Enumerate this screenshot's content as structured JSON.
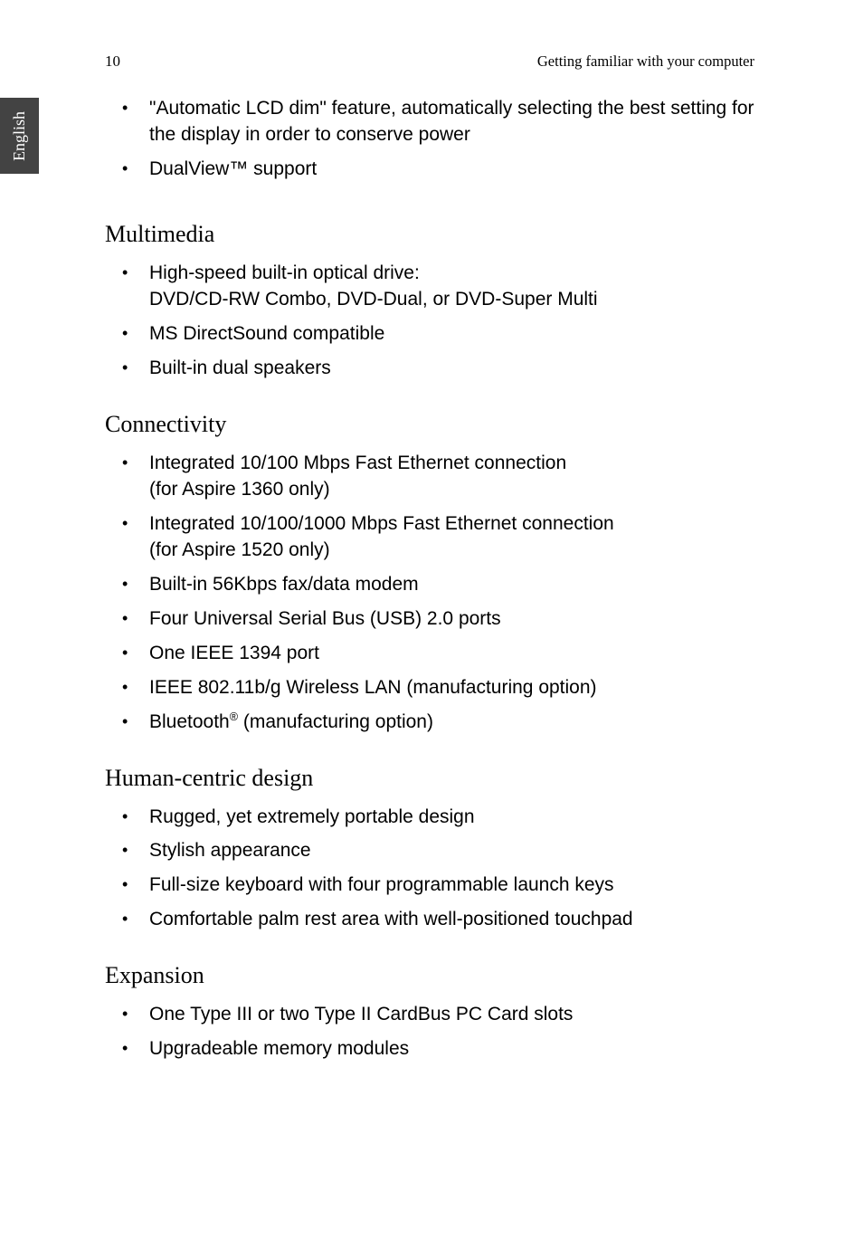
{
  "page_number": "10",
  "header": "Getting familiar with your computer",
  "side_tab": "English",
  "top_items": [
    {
      "text": "\"Automatic LCD dim\" feature, automatically selecting the best setting for the display in order to conserve power"
    },
    {
      "text": "DualView™ support"
    }
  ],
  "sections": [
    {
      "heading": "Multimedia",
      "items": [
        {
          "line1": "High-speed built-in optical drive:",
          "line2": "DVD/CD-RW Combo, DVD-Dual, or DVD-Super Multi"
        },
        {
          "text": "MS DirectSound compatible"
        },
        {
          "text": "Built-in dual speakers"
        }
      ]
    },
    {
      "heading": "Connectivity",
      "items": [
        {
          "line1": "Integrated 10/100 Mbps Fast Ethernet connection",
          "line2": "(for Aspire 1360 only)"
        },
        {
          "line1": "Integrated 10/100/1000 Mbps Fast Ethernet connection",
          "line2": "(for Aspire 1520 only)"
        },
        {
          "text": "Built-in 56Kbps fax/data modem"
        },
        {
          "text": "Four Universal Serial Bus (USB) 2.0 ports"
        },
        {
          "text": "One IEEE 1394 port"
        },
        {
          "text": "IEEE 802.11b/g Wireless LAN (manufacturing option)"
        },
        {
          "html": "Bluetooth<sup>®</sup> (manufacturing option)"
        }
      ]
    },
    {
      "heading": "Human-centric design",
      "items": [
        {
          "text": "Rugged, yet extremely portable design"
        },
        {
          "text": "Stylish appearance"
        },
        {
          "text": "Full-size keyboard with four programmable launch keys"
        },
        {
          "text": "Comfortable palm rest area with well-positioned touchpad"
        }
      ]
    },
    {
      "heading": "Expansion",
      "items": [
        {
          "text": "One Type III or two Type II CardBus PC Card slots"
        },
        {
          "text": "Upgradeable memory modules"
        }
      ]
    }
  ]
}
